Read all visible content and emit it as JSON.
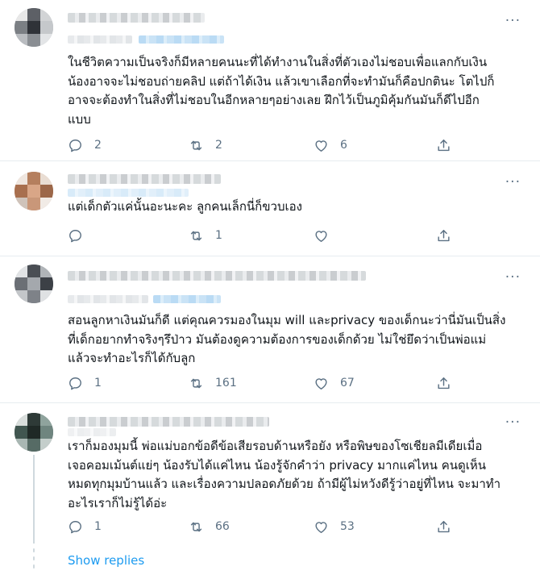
{
  "icons": {
    "more": "more-horizontal-icon",
    "reply": "reply-icon",
    "retweet": "retweet-icon",
    "like": "heart-icon",
    "share": "share-icon"
  },
  "colors": {
    "text": "#0f1419",
    "secondary": "#5b7083",
    "link": "#1d9bf0",
    "divider": "#e6ecf0"
  },
  "tweets": [
    {
      "more": "···",
      "lines": [
        "ในชีวิตความเป็นจริงก็มีหลายคนนะที่ได้ทำงานในสิ่งที่ตัวเองไม่ชอบเพื่อแลกกับเงิน",
        "น้องอาจจะไม่ชอบถ่ายคลิป แต่ถ้าได้เงิน แล้วเขาเลือกที่จะทำมันก็คือปกตินะ โตไปก็",
        "อาจจะต้องทำในสิ่งที่ไม่ชอบในอีกหลายๆอย่างเลย ฝึกไว้เป็นภูมิคุ้มกันมันก็ดีไปอีก",
        "แบบ"
      ],
      "replies": "2",
      "retweets": "2",
      "likes": "6"
    },
    {
      "more": "···",
      "lines": [
        "แต่เด็กตัวแค่นั้นอะนะคะ ลูกคนเล็กนี่ก็ขวบเอง"
      ],
      "replies": "",
      "retweets": "1",
      "likes": ""
    },
    {
      "more": "···",
      "lines": [
        "สอนลูกหาเงินมันก็ดี แต่คุณควรมองในมุม will และprivacy ของเด็กนะว่านี่มันเป็นสิ่ง",
        "ที่เด็กอยากทำจริงๆรึป่าว มันต้องดูความต้องการของเด็กด้วย ไม่ใช่ยึดว่าเป็นพ่อแม่",
        "แล้วจะทำอะไรก็ได้กับลูก"
      ],
      "replies": "1",
      "retweets": "161",
      "likes": "67"
    },
    {
      "more": "···",
      "lines": [
        "เราก็มองมุมนี้ พ่อแม่บอกข้อดีข้อเสียรอบด้านหรือยัง หรือพิษของโซเชียลมีเดียเมื่อ",
        "เจอคอมเม้นต์แย่ๆ น้องรับได้แค่ไหน น้องรู้จักคำว่า privacy มากแค่ไหน คนดูเห็น",
        "หมดทุกมุมบ้านแล้ว และเรื่องความปลอดภัยด้วย ถ้ามีผู้ไม่หวังดีรู้ว่าอยู่ที่ไหน จะมาทำ",
        "อะไรเราก็ไม่รู้ได้อ่ะ"
      ],
      "replies": "1",
      "retweets": "66",
      "likes": "53"
    }
  ],
  "show_replies": "Show replies"
}
